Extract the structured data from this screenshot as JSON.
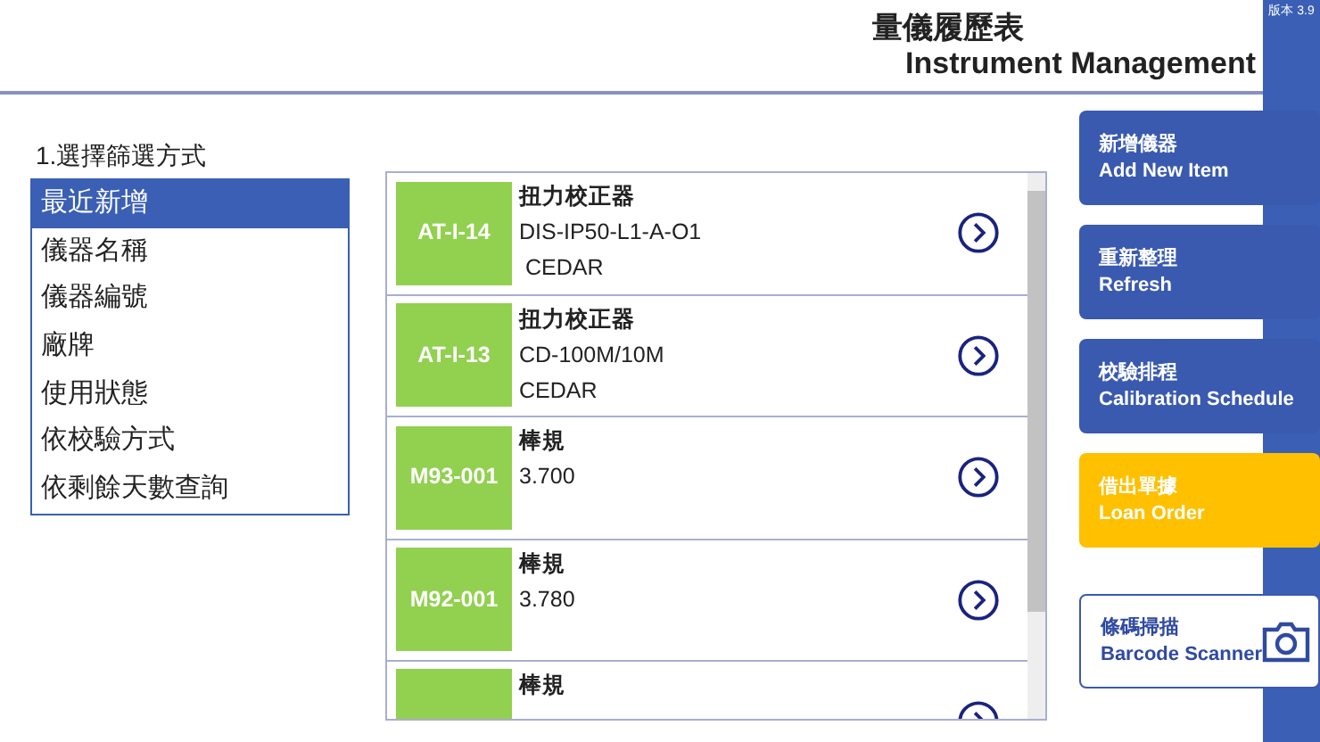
{
  "header": {
    "title_zh": "量儀履歷表",
    "title_en": "Instrument Management",
    "version": "版本 3.9"
  },
  "filter": {
    "label": "1.選擇篩選方式",
    "options": [
      {
        "label": "最近新增",
        "selected": true
      },
      {
        "label": "儀器名稱",
        "selected": false
      },
      {
        "label": "儀器編號",
        "selected": false
      },
      {
        "label": "廠牌",
        "selected": false
      },
      {
        "label": "使用狀態",
        "selected": false
      },
      {
        "label": "依校驗方式",
        "selected": false
      },
      {
        "label": "依剩餘天數查詢",
        "selected": false
      }
    ]
  },
  "instruments": [
    {
      "code": "AT-I-14",
      "name": "扭力校正器",
      "lines": [
        "DIS-IP50-L1-A-O1",
        " CEDAR"
      ]
    },
    {
      "code": "AT-I-13",
      "name": "扭力校正器",
      "lines": [
        "CD-100M/10M",
        "CEDAR"
      ]
    },
    {
      "code": "M93-001",
      "name": "棒規",
      "lines": [
        "3.700"
      ]
    },
    {
      "code": "M92-001",
      "name": "棒規",
      "lines": [
        "3.780"
      ]
    },
    {
      "name": "棒規"
    }
  ],
  "actions": [
    {
      "kind": "primary",
      "title_zh": "新增儀器",
      "title_en": "Add New Item"
    },
    {
      "kind": "primary",
      "title_zh": "重新整理",
      "title_en": "Refresh"
    },
    {
      "kind": "primary",
      "title_zh": "校驗排程",
      "title_en": "Calibration Schedule"
    },
    {
      "kind": "warning",
      "title_zh": "借出單據",
      "title_en": "Loan Order"
    },
    {
      "kind": "scanner",
      "title_zh": "條碼掃描",
      "title_en": "Barcode Scanner"
    }
  ]
}
